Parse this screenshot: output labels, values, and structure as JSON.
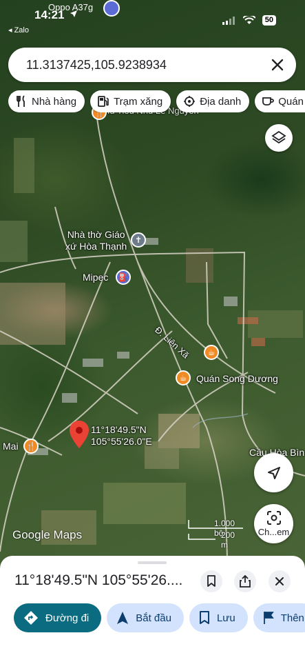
{
  "status_bar": {
    "time": "14:21",
    "carrier": "Oppo A37g",
    "back_app": "◂ Zalo",
    "battery": "50"
  },
  "search": {
    "value": "11.3137425,105.9238934"
  },
  "chips": [
    {
      "label": "Nhà hàng",
      "icon": "fork-knife-icon"
    },
    {
      "label": "Trạm xăng",
      "icon": "gas-station-icon"
    },
    {
      "label": "Địa danh",
      "icon": "landmark-icon"
    },
    {
      "label": "Quán c",
      "icon": "cafe-icon"
    }
  ],
  "map": {
    "labels": {
      "top_partial": "Hủ Tiếu Nhu Lê Nguyên",
      "church": "Nhà thờ Giáo\nxứ Hòa Thạnh",
      "mipec": "Mipec",
      "road": "Đ. Liên Xã",
      "cafe": "Quán Song Dương",
      "mai": "Mai",
      "bridge": "Cầu Hòa Bìn",
      "pin_lat": "11°18'49.5\"N",
      "pin_lng": "105°55'26.0\"E"
    },
    "google_logo": "Google Maps",
    "scale_top": "1.000 bộ",
    "scale_bottom": "200 m",
    "lens_label": "Ch...em"
  },
  "sheet": {
    "title": "11°18'49.5\"N 105°55'26....",
    "actions": [
      {
        "label": "Đường đi",
        "icon": "directions-icon"
      },
      {
        "label": "Bắt đầu",
        "icon": "navigation-arrow-icon"
      },
      {
        "label": "Lưu",
        "icon": "bookmark-icon"
      },
      {
        "label": "Thên",
        "icon": "flag-icon"
      }
    ]
  },
  "colors": {
    "primary_action": "#0b6b80",
    "secondary_action": "#d3e3fd",
    "pin": "#ea4335",
    "cafe_orange": "#f08a24",
    "poi_blue": "#5b6bd6"
  }
}
